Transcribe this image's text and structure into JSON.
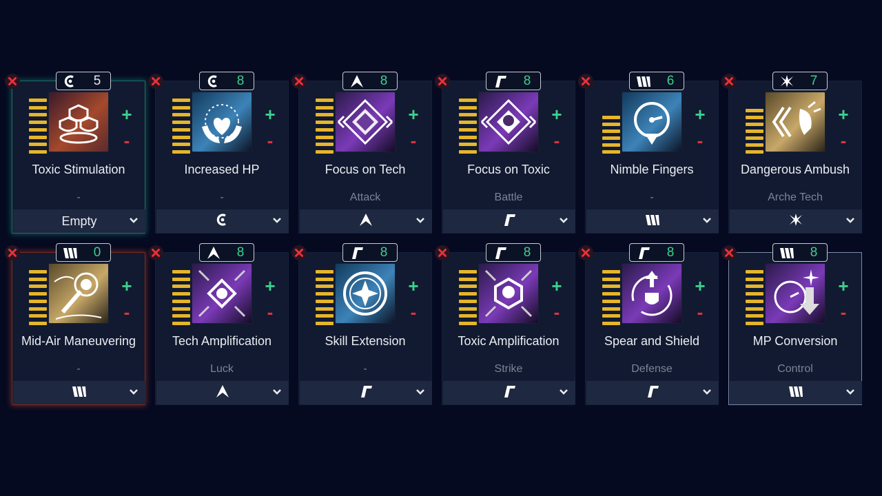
{
  "colors": {
    "background": "#050a21",
    "card": "#111a30",
    "accent_green": "#3ecf8e",
    "accent_red": "#d9353f",
    "bar_gold": "#e6b52a"
  },
  "controls": {
    "plus": "+",
    "minus": "-"
  },
  "cards": [
    {
      "name": "Toxic Stimulation",
      "category": "-",
      "dropdown": "Empty",
      "dropdown_icon": "",
      "badge_icon": "c-icon",
      "badge_value": "5",
      "badge_green": false,
      "art": "triple-mask-icon",
      "art_theme": "orange",
      "bars": 8,
      "state": "teal"
    },
    {
      "name": "Increased HP",
      "category": "-",
      "dropdown": "",
      "dropdown_icon": "c-icon",
      "badge_icon": "c-icon",
      "badge_value": "8",
      "badge_green": true,
      "art": "heart-hands-icon",
      "art_theme": "blue",
      "bars": 8,
      "state": ""
    },
    {
      "name": "Focus on Tech",
      "category": "Attack",
      "dropdown": "",
      "dropdown_icon": "a-icon",
      "badge_icon": "a-icon",
      "badge_value": "8",
      "badge_green": true,
      "art": "diamond-tech-icon",
      "art_theme": "purple",
      "bars": 8,
      "state": ""
    },
    {
      "name": "Focus on Toxic",
      "category": "Battle",
      "dropdown": "",
      "dropdown_icon": "r-icon",
      "badge_icon": "r-icon",
      "badge_value": "8",
      "badge_green": true,
      "art": "diamond-skull-icon",
      "art_theme": "purple",
      "bars": 8,
      "state": ""
    },
    {
      "name": "Nimble Fingers",
      "category": "-",
      "dropdown": "",
      "dropdown_icon": "m-icon",
      "badge_icon": "m-icon",
      "badge_value": "6",
      "badge_green": true,
      "art": "gauge-arrow-icon",
      "art_theme": "blue",
      "bars": 6,
      "state": ""
    },
    {
      "name": "Dangerous Ambush",
      "category": "Arche Tech",
      "dropdown": "",
      "dropdown_icon": "x-icon",
      "badge_icon": "x-icon",
      "badge_value": "7",
      "badge_green": true,
      "art": "ambush-icon",
      "art_theme": "gold",
      "bars": 7,
      "state": ""
    },
    {
      "name": "Mid-Air Maneuvering",
      "category": "-",
      "dropdown": "",
      "dropdown_icon": "m-icon",
      "badge_icon": "m-icon",
      "badge_value": "0",
      "badge_green": true,
      "art": "grapple-icon",
      "art_theme": "gold",
      "bars": 8,
      "state": "red"
    },
    {
      "name": "Tech Amplification",
      "category": "Luck",
      "dropdown": "",
      "dropdown_icon": "a-icon",
      "badge_icon": "a-icon",
      "badge_value": "8",
      "badge_green": true,
      "art": "diamond-arrows-icon",
      "art_theme": "purple",
      "bars": 8,
      "state": ""
    },
    {
      "name": "Skill Extension",
      "category": "-",
      "dropdown": "",
      "dropdown_icon": "r-icon",
      "badge_icon": "r-icon",
      "badge_value": "8",
      "badge_green": true,
      "art": "star-circle-icon",
      "art_theme": "blue",
      "bars": 8,
      "state": ""
    },
    {
      "name": "Toxic Amplification",
      "category": "Strike",
      "dropdown": "",
      "dropdown_icon": "r-icon",
      "badge_icon": "r-icon",
      "badge_value": "8",
      "badge_green": true,
      "art": "hex-skull-arrows-icon",
      "art_theme": "purple",
      "bars": 8,
      "state": ""
    },
    {
      "name": "Spear and Shield",
      "category": "Defense",
      "dropdown": "",
      "dropdown_icon": "r-icon",
      "badge_icon": "r-icon",
      "badge_value": "8",
      "badge_green": true,
      "art": "shield-arrow-icon",
      "art_theme": "purple",
      "bars": 8,
      "state": ""
    },
    {
      "name": "MP Conversion",
      "category": "Control",
      "dropdown": "",
      "dropdown_icon": "m-icon",
      "badge_icon": "m-icon",
      "badge_value": "8",
      "badge_green": true,
      "art": "gauge-down-icon",
      "art_theme": "purple",
      "bars": 8,
      "state": "selected"
    }
  ]
}
